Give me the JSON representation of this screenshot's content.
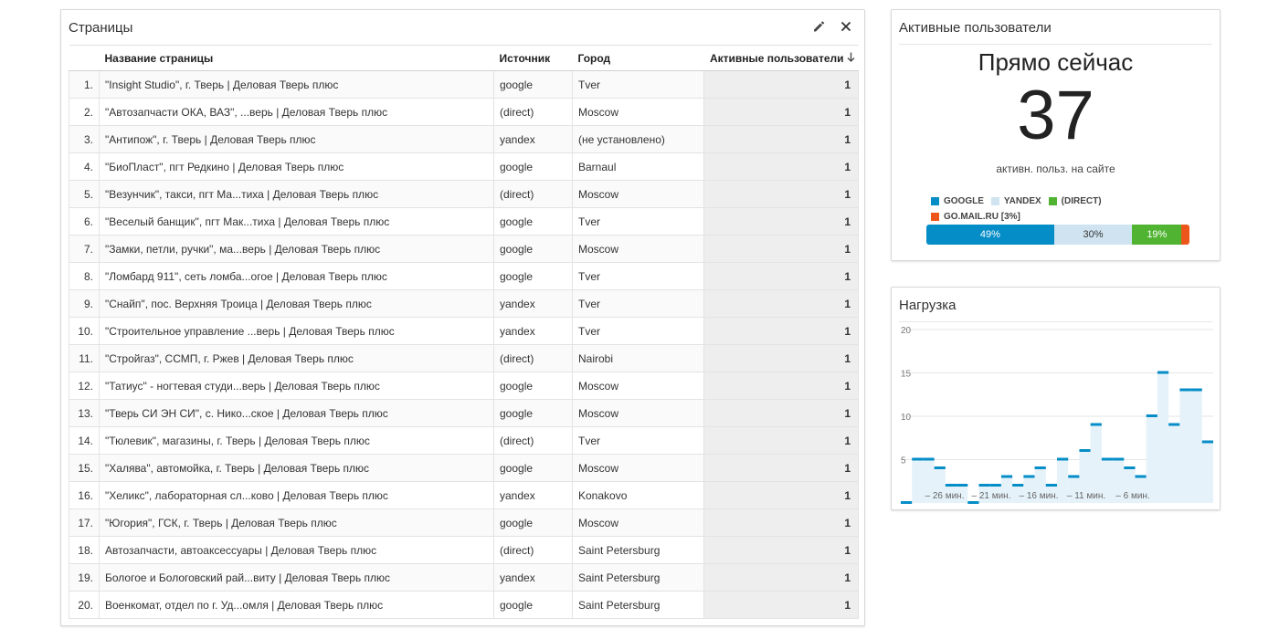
{
  "pages_card": {
    "title": "Страницы",
    "columns": [
      "",
      "Название страницы",
      "Источник",
      "Город",
      "Активные пользователи"
    ],
    "rows": [
      [
        "1.",
        "\"Insight Studio\", г. Тверь | Деловая Тверь плюс",
        "google",
        "Tver",
        "1"
      ],
      [
        "2.",
        "\"Автозапчасти ОКА, ВАЗ\", ...верь | Деловая Тверь плюс",
        "(direct)",
        "Moscow",
        "1"
      ],
      [
        "3.",
        "\"Антипож\", г. Тверь | Деловая Тверь плюс",
        "yandex",
        "(не установлено)",
        "1"
      ],
      [
        "4.",
        "\"БиоПласт\", пгт Редкино | Деловая Тверь плюс",
        "google",
        "Barnaul",
        "1"
      ],
      [
        "5.",
        "\"Везунчик\", такси, пгт Ма...тиха | Деловая Тверь плюс",
        "(direct)",
        "Moscow",
        "1"
      ],
      [
        "6.",
        "\"Веселый банщик\", пгт Мак...тиха | Деловая Тверь плюс",
        "google",
        "Tver",
        "1"
      ],
      [
        "7.",
        "\"Замки, петли, ручки\", ма...верь | Деловая Тверь плюс",
        "google",
        "Moscow",
        "1"
      ],
      [
        "8.",
        "\"Ломбард 911\", сеть ломба...огое | Деловая Тверь плюс",
        "google",
        "Tver",
        "1"
      ],
      [
        "9.",
        "\"Снайп\", пос. Верхняя Троица | Деловая Тверь плюс",
        "yandex",
        "Tver",
        "1"
      ],
      [
        "10.",
        "\"Строительное управление ...верь | Деловая Тверь плюс",
        "yandex",
        "Tver",
        "1"
      ],
      [
        "11.",
        "\"Стройгаз\", ССМП, г. Ржев | Деловая Тверь плюс",
        "(direct)",
        "Nairobi",
        "1"
      ],
      [
        "12.",
        "\"Татиус\" - ногтевая студи...верь | Деловая Тверь плюс",
        "google",
        "Moscow",
        "1"
      ],
      [
        "13.",
        "\"Тверь СИ ЭН СИ\", с. Нико...ское | Деловая Тверь плюс",
        "google",
        "Moscow",
        "1"
      ],
      [
        "14.",
        "\"Тюлевик\", магазины, г. Тверь | Деловая Тверь плюс",
        "(direct)",
        "Tver",
        "1"
      ],
      [
        "15.",
        "\"Халява\", автомойка, г. Тверь | Деловая Тверь плюс",
        "google",
        "Moscow",
        "1"
      ],
      [
        "16.",
        "\"Хеликс\", лабораторная сл...ково | Деловая Тверь плюс",
        "yandex",
        "Konakovo",
        "1"
      ],
      [
        "17.",
        "\"Югория\", ГСК, г. Тверь | Деловая Тверь плюс",
        "google",
        "Moscow",
        "1"
      ],
      [
        "18.",
        "Автозапчасти, автоаксессуары | Деловая Тверь плюс",
        "(direct)",
        "Saint Petersburg",
        "1"
      ],
      [
        "19.",
        "Бологое и Бологовский рай...виту | Деловая Тверь плюс",
        "yandex",
        "Saint Petersburg",
        "1"
      ],
      [
        "20.",
        "Военкомат, отдел по г. Уд...омля | Деловая Тверь плюс",
        "google",
        "Saint Petersburg",
        "1"
      ]
    ],
    "edit_icon": "pencil-icon",
    "close_icon": "close-icon",
    "sort_icon": "arrow-down-icon"
  },
  "active_card": {
    "title": "Активные пользователи",
    "now_label": "Прямо сейчас",
    "count": "37",
    "sub_label": "активн. польз. на сайте",
    "legend": [
      {
        "label": "GOOGLE",
        "color": "#058dc7"
      },
      {
        "label": "YANDEX",
        "color": "#cfe4f0"
      },
      {
        "label": "(DIRECT)",
        "color": "#50b432"
      },
      {
        "label": "GO.MAIL.RU [3%]",
        "color": "#ed561b"
      }
    ],
    "bar": [
      {
        "label": "49%",
        "value": 49,
        "color": "#058dc7"
      },
      {
        "label": "30%",
        "value": 30,
        "color": "#cfe4f0"
      },
      {
        "label": "19%",
        "value": 19,
        "color": "#50b432"
      },
      {
        "label": "",
        "value": 3,
        "color": "#ed561b"
      }
    ]
  },
  "load_card": {
    "title": "Нагрузка",
    "chart_data": {
      "type": "bar",
      "y_ticks": [
        "20",
        "15",
        "10",
        "5"
      ],
      "ylim": [
        0,
        20
      ],
      "x_tick_labels": [
        "– 26 мин.",
        "– 21 мин.",
        "– 16 мин.",
        "– 11 мин.",
        "– 6 мин."
      ],
      "values": [
        0,
        5,
        5,
        4,
        2,
        2,
        0,
        2,
        2,
        3,
        2,
        3,
        4,
        2,
        5,
        3,
        6,
        9,
        5,
        5,
        4,
        3,
        10,
        15,
        9,
        13,
        13,
        7
      ],
      "bar_color": "#058dc7",
      "fill_color": "#e5f2f9"
    }
  }
}
